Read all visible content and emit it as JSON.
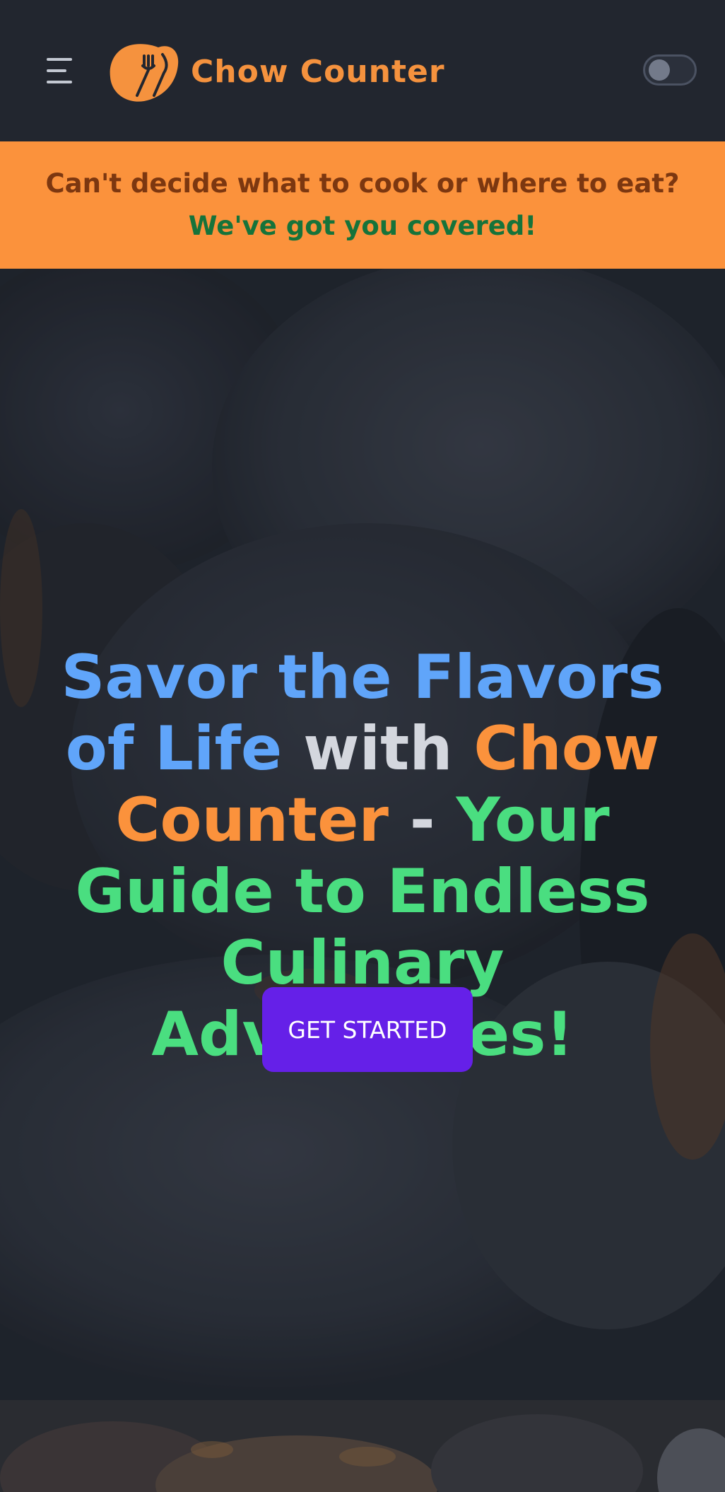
{
  "header": {
    "brand_name": "Chow Counter",
    "menu_icon": "hamburger-menu-icon",
    "logo_icon": "fork-knife-logo-icon",
    "theme_toggle_icon": "dark-mode-toggle",
    "theme_toggle_state": "off"
  },
  "banner": {
    "line1": "Can't decide what to cook or where to eat?",
    "line2": "We've got you covered!"
  },
  "hero": {
    "title_part1": "Savor the Flavors of Life",
    "title_part2": "with",
    "title_part3": "Chow Counter",
    "title_part4": "-",
    "title_part5": "Your Guide to Endless Culinary Adventures!",
    "cta_label": "GET STARTED",
    "background": "dark food photo (bread rolls)"
  },
  "colors": {
    "navbar_bg": "#22262f",
    "brand": "#f5923e",
    "banner_bg": "#fb923c",
    "banner_text": "#7c3710",
    "banner_highlight": "#16733a",
    "title_blue": "#60a5fa",
    "title_gray": "#d4d7de",
    "title_orange": "#fb923c",
    "title_green": "#4ade80",
    "cta_bg": "#6520e8"
  }
}
